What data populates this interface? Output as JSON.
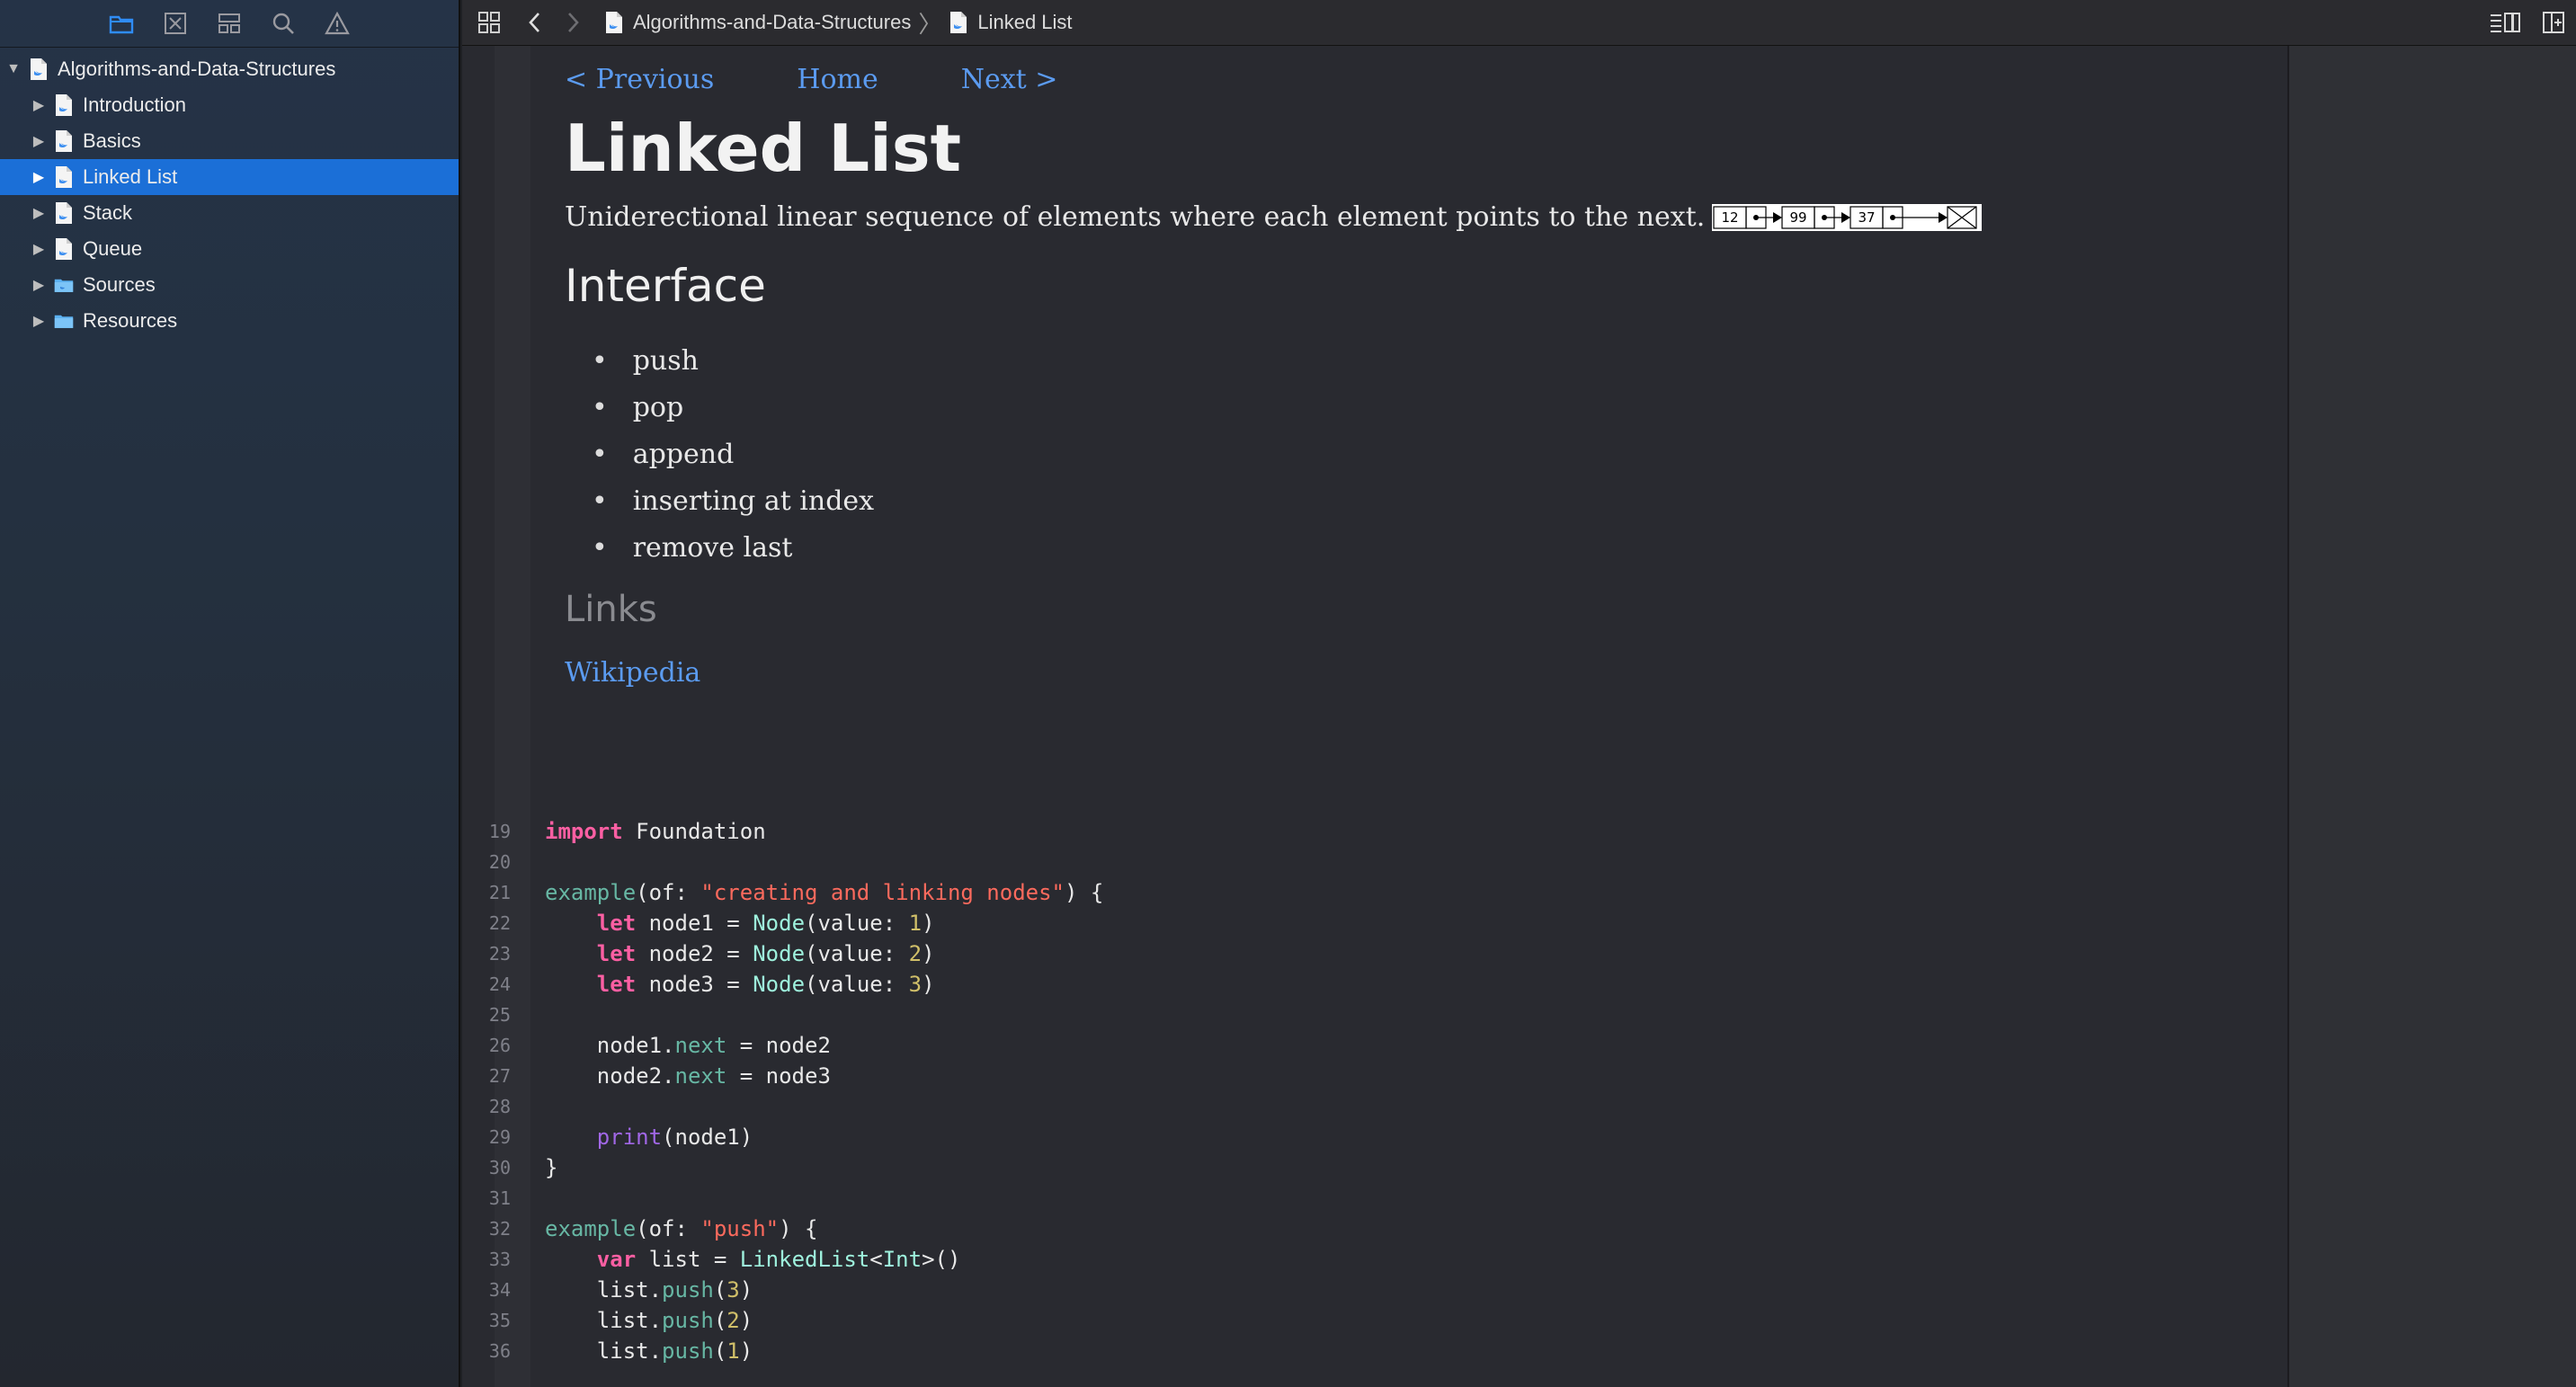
{
  "sidebar": {
    "tree": [
      {
        "label": "Algorithms-and-Data-Structures",
        "kind": "playground",
        "level": 0,
        "expanded": true
      },
      {
        "label": "Introduction",
        "kind": "page",
        "level": 1
      },
      {
        "label": "Basics",
        "kind": "page",
        "level": 1
      },
      {
        "label": "Linked List",
        "kind": "page",
        "level": 1,
        "selected": true
      },
      {
        "label": "Stack",
        "kind": "page",
        "level": 1
      },
      {
        "label": "Queue",
        "kind": "page",
        "level": 1
      },
      {
        "label": "Sources",
        "kind": "folder",
        "level": 1
      },
      {
        "label": "Resources",
        "kind": "folder",
        "level": 1
      }
    ]
  },
  "toolbar": {
    "breadcrumb": [
      "Algorithms-and-Data-Structures",
      "Linked List"
    ]
  },
  "doc": {
    "nav": {
      "previous": "< Previous",
      "home": "Home",
      "next": "Next >"
    },
    "title": "Linked List",
    "description": "Uniderectional linear sequence of elements where each element points to the next.",
    "diagram_values": [
      "12",
      "99",
      "37"
    ],
    "interface_heading": "Interface",
    "interface_items": [
      "push",
      "pop",
      "append",
      "inserting at index",
      "remove last"
    ],
    "links_heading": "Links",
    "links": [
      "Wikipedia"
    ]
  },
  "code": {
    "lines": [
      {
        "n": "19"
      },
      {
        "n": "20"
      },
      {
        "n": "21"
      },
      {
        "n": "22"
      },
      {
        "n": "23"
      },
      {
        "n": "24"
      },
      {
        "n": "25"
      },
      {
        "n": "26"
      },
      {
        "n": "27"
      },
      {
        "n": "28"
      },
      {
        "n": "29"
      },
      {
        "n": "30"
      },
      {
        "n": "31"
      },
      {
        "n": "32"
      },
      {
        "n": "33"
      },
      {
        "n": "34"
      },
      {
        "n": "35"
      },
      {
        "n": "36"
      }
    ],
    "tokens": {
      "import_kw": "import",
      "foundation": "Foundation",
      "example": "example",
      "of_label": "(of: ",
      "str1": "\"creating and linking nodes\"",
      "paren_brace": ") {",
      "let_kw": "let",
      "node1": "node1",
      "node2": "node2",
      "node3": "node3",
      "Node": "Node",
      "value_label": "(value: ",
      "v1": "1",
      "v2": "2",
      "v3": "3",
      "close": ")",
      "next": "next",
      "eq": " = ",
      "dot": ".",
      "print": "print",
      "print_arg": "(node1)",
      "brace_close": "}",
      "str2": "\"push\"",
      "var_kw": "var",
      "list": "list",
      "LinkedList": "LinkedList",
      "Int": "Int",
      "lt": "<",
      "gt_call": ">()",
      "push": "push",
      "p3": "3",
      "p2": "2",
      "p1": "1"
    }
  },
  "colors": {
    "accent": "#1b6fd7",
    "link": "#5b9bf0",
    "keyword": "#fc5fa3",
    "string": "#fc6a5d",
    "number": "#d0bf69",
    "type": "#9ef1dd",
    "function": "#a167e6"
  }
}
